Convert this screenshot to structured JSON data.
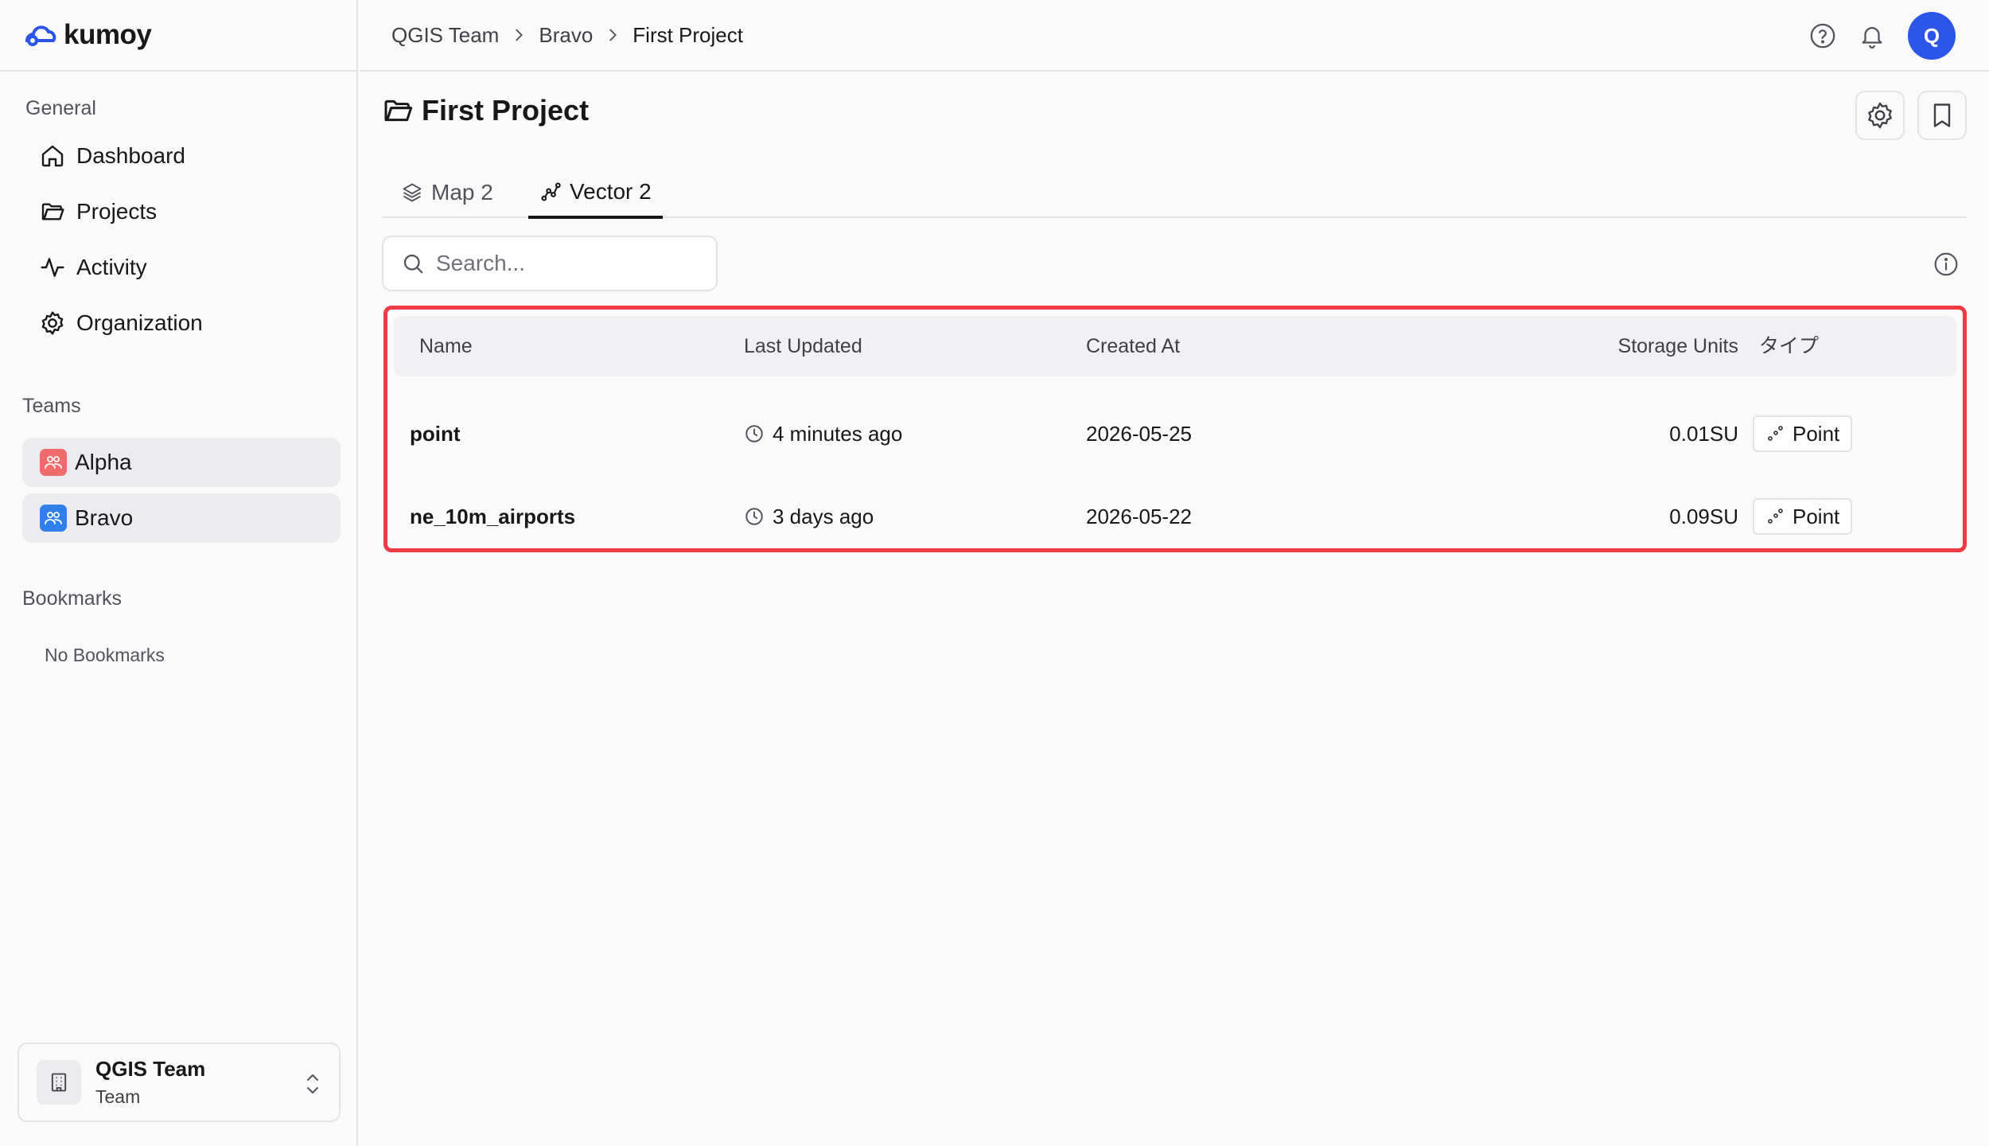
{
  "app": {
    "logo_text": "kumoy"
  },
  "sidebar": {
    "general_label": "General",
    "nav": [
      {
        "label": "Dashboard",
        "icon": "home-icon"
      },
      {
        "label": "Projects",
        "icon": "folder-icon"
      },
      {
        "label": "Activity",
        "icon": "activity-icon"
      },
      {
        "label": "Organization",
        "icon": "gear-icon"
      }
    ],
    "teams_label": "Teams",
    "teams": [
      {
        "label": "Alpha",
        "color": "#f26b6b"
      },
      {
        "label": "Bravo",
        "color": "#2f80ed"
      }
    ],
    "bookmarks_label": "Bookmarks",
    "no_bookmarks": "No Bookmarks",
    "team_switcher": {
      "name": "QGIS Team",
      "role": "Team"
    }
  },
  "breadcrumb": {
    "items": [
      "QGIS Team",
      "Bravo",
      "First Project"
    ]
  },
  "header": {
    "avatar_initial": "Q",
    "avatar_color": "#2b55e6"
  },
  "project": {
    "title": "First Project"
  },
  "tabs": [
    {
      "label": "Map 2",
      "active": false
    },
    {
      "label": "Vector 2",
      "active": true
    }
  ],
  "search": {
    "placeholder": "Search..."
  },
  "table": {
    "columns": [
      "Name",
      "Last Updated",
      "Created At",
      "Storage Units",
      "タイプ"
    ],
    "rows": [
      {
        "name": "point",
        "last_updated": "4 minutes ago",
        "created_at": "2026-05-25",
        "storage": "0.01SU",
        "type": "Point"
      },
      {
        "name": "ne_10m_airports",
        "last_updated": "3 days ago",
        "created_at": "2026-05-22",
        "storage": "0.09SU",
        "type": "Point"
      }
    ],
    "highlight_color": "#ef3b43"
  }
}
